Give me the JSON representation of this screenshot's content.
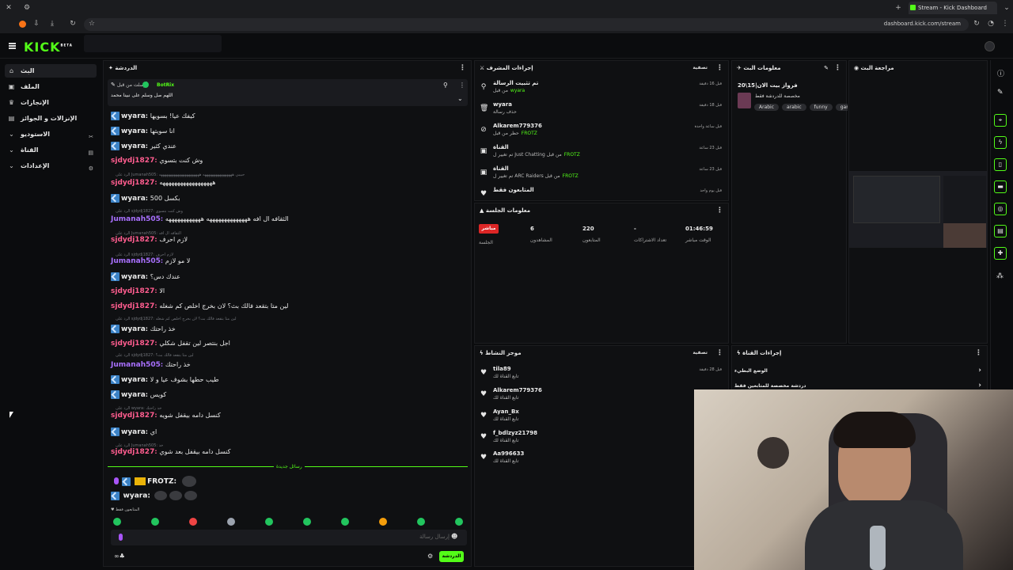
{
  "browser": {
    "tab_title": "Stream - Kick Dashboard",
    "url": "dashboard.kick.com/stream"
  },
  "app": {
    "logo": "KICK",
    "logo_sup": "BETA"
  },
  "sidebar": {
    "items": [
      {
        "label": "البث",
        "icon": "house-icon"
      },
      {
        "label": "الملف",
        "icon": "profile-icon"
      },
      {
        "label": "الإنجازات",
        "icon": "trophy-icon"
      },
      {
        "label": "الإنزالات و الجوائز",
        "icon": "gift-icon"
      },
      {
        "label": "الاستوديو",
        "icon": "studio-icon"
      },
      {
        "label": "القناة",
        "icon": "channel-icon"
      },
      {
        "label": "الإعدادات",
        "icon": "gear-icon"
      }
    ]
  },
  "chat": {
    "title": "الدردشة",
    "pinned": {
      "by": "أرسلت من قبل",
      "user": "BotRix",
      "text": "اللهم صل وسلم على نبينا محمد"
    },
    "messages": [
      {
        "user": "wyara",
        "text": "كيفك عيا! بسويها",
        "color": "#ffffff",
        "badge": true
      },
      {
        "user": "wyara",
        "text": "انا سويتها",
        "color": "#ffffff",
        "badge": true
      },
      {
        "user": "wyara",
        "text": "عندي كثير",
        "color": "#ffffff",
        "badge": true
      },
      {
        "user": "sjdydj1827",
        "text": "وش كنت بتسوي",
        "color": "#ff5d8f"
      },
      {
        "user": "sjdydj1827",
        "text": "ههههههههههههههههههه",
        "color": "#ff5d8f"
      },
      {
        "user": "wyara",
        "text": "بكسل 500",
        "color": "#ffffff",
        "badge": true
      },
      {
        "user": "Jumanah505",
        "text": "الثقافه ال افه ههههههههههههههه ههههههههههههه",
        "color": "#a970ff"
      },
      {
        "user": "sjdydj1827",
        "text": "لازم احرف",
        "color": "#ff5d8f"
      },
      {
        "user": "Jumanah505",
        "text": "لا مو لازم",
        "color": "#a970ff"
      },
      {
        "user": "wyara",
        "text": "عندك دس؟",
        "color": "#ffffff",
        "badge": true
      },
      {
        "user": "sjdydj1827",
        "text": "الا",
        "color": "#ff5d8f"
      },
      {
        "user": "sjdydj1827",
        "text": "لين متا بتقعد فالك بث؟ لان بخرج اخلص كم شغله",
        "color": "#ff5d8f"
      },
      {
        "user": "wyara",
        "text": "خذ راحتك",
        "color": "#ffffff",
        "badge": true
      },
      {
        "user": "sjdydj1827",
        "text": "اجل بنتصر لين تقفل شكلي",
        "color": "#ff5d8f"
      },
      {
        "user": "Jumanah505",
        "text": "خذ راحتك",
        "color": "#a970ff"
      },
      {
        "user": "wyara",
        "text": "طيب حطها بشوف عيا و لا",
        "color": "#ffffff",
        "badge": true
      },
      {
        "user": "wyara",
        "text": "كويس",
        "color": "#ffffff",
        "badge": true
      },
      {
        "user": "sjdydj1827",
        "text": "كنسل دامه بيقفل شويه",
        "color": "#ff5d8f"
      },
      {
        "user": "wyara",
        "text": "اي",
        "color": "#ffffff",
        "badge": true
      },
      {
        "user": "sjdydj1827",
        "text": "كنسل دامه بيقفل بعد شوي",
        "color": "#ff5d8f"
      }
    ],
    "replies": [
      "الرد على Jumanah505: حبيبي ههههههههههههههههه ههههههههههههههههههههههه",
      "الرد على sjdydj1827: وش كنت بتسوي",
      "الرد على Jumanah505: الثقافه ال افه",
      "الرد على sjdydj1827: لازم احرف",
      "الرد على sjdydj1827: لين متا بتقعد فالك بث؟ لان بخرج اخلص كم شغله",
      "الرد على sjdydj1827: لين متا بتقعد فالك بث؟",
      "الرد على wyara: خذ راحتك",
      "الرد على Jumanah505: خذ"
    ],
    "new_messages": "رسائل جديدة",
    "frotz": "FROTZ:",
    "wyara2": "wyara:",
    "followers_only": "المتابعون فقط",
    "input_placeholder": "إرسال رسالة",
    "send": "الدردشة"
  },
  "mod": {
    "title": "إجراءات المشرف",
    "filter": "تصفية",
    "items": [
      {
        "title": "تم تثبيت الرسالة",
        "sub": "من قبل",
        "subuser": "wyara",
        "time": "قبل 16 دقيقة",
        "icon": "pin-icon"
      },
      {
        "title": "wyara",
        "sub": "حذف رسالة",
        "subuser": "",
        "time": "قبل 18 دقيقة",
        "icon": "trash-icon"
      },
      {
        "title": "Alkarem779376",
        "sub": "حظر من قبل",
        "subuser": "FROTZ",
        "time": "قبل ساعة واحدة",
        "icon": "ban-icon"
      },
      {
        "title": "القناة",
        "sub": "تم تغيير ل Just Chatting من قبل",
        "subuser": "FROTZ",
        "time": "قبل 23 ساعة",
        "icon": "channel-icon"
      },
      {
        "title": "القناة",
        "sub": "تم تغيير ل ARC Raiders من قبل",
        "subuser": "FROTZ",
        "time": "قبل 23 ساعة",
        "icon": "channel-icon"
      },
      {
        "title": "المتابعون فقط",
        "sub": "",
        "subuser": "",
        "time": "قبل يوم واحد",
        "icon": "heart-icon"
      }
    ]
  },
  "session": {
    "title": "معلومات الجلسة",
    "live": "مباشر",
    "live_label": "الجلسة",
    "stats": [
      {
        "value": "6",
        "label": "المشاهدون"
      },
      {
        "value": "220",
        "label": "المتابعون"
      },
      {
        "value": "-",
        "label": "تعداد الاشتراكات"
      },
      {
        "value": "01:46:59",
        "label": "الوقت مباشر"
      }
    ]
  },
  "stream_info": {
    "title": "معلومات البث",
    "stream_title": "فرواز بيت الان|15\\20",
    "category": "مخصصة للدردشة فقط",
    "tags": [
      "Arabic",
      "arabic",
      "funny",
      "gaming"
    ]
  },
  "preview": {
    "title": "مراجعة البث"
  },
  "activity": {
    "title": "موجز النشاط",
    "filter": "تصفية",
    "items": [
      {
        "user": "tila89",
        "sub": "تابع القناة لك",
        "time": "قبل 28 دقيقة"
      },
      {
        "user": "Alkarem779376",
        "sub": "تابع القناة لك",
        "time": ""
      },
      {
        "user": "Ayan_Bx",
        "sub": "تابع القناة لك",
        "time": ""
      },
      {
        "user": "f_bdlzyz21798",
        "sub": "تابع القناة لك",
        "time": ""
      },
      {
        "user": "Aa996633",
        "sub": "تابع القناة لك",
        "time": ""
      }
    ]
  },
  "channel_actions": {
    "title": "إجراءات القناة",
    "items": [
      "الوضع البطيء",
      "دردشة مخصصة للمتابعين فقط"
    ]
  },
  "colors": {
    "accent": "#53fc18",
    "bg": "#0b0c0e",
    "panel": "#0f1012"
  }
}
